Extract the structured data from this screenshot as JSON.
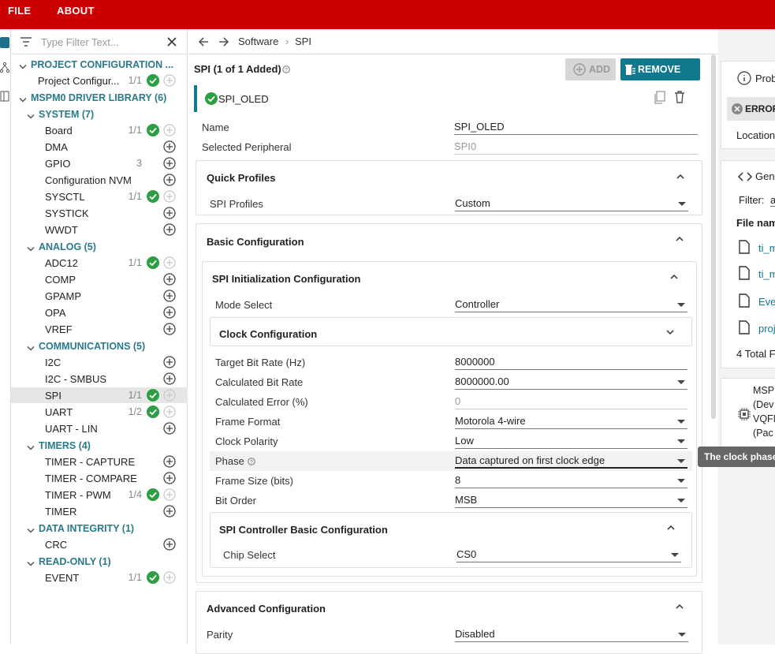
{
  "menu": {
    "file": "FILE",
    "about": "ABOUT"
  },
  "filter": {
    "placeholder": "Type Filter Text..."
  },
  "tree": {
    "project_cat": "PROJECT CONFIGURATION ...",
    "project_item": {
      "label": "Project Configur...",
      "count": "1/1"
    },
    "driver_cat": "MSPM0 DRIVER LIBRARY (6)",
    "system_cat": "SYSTEM (7)",
    "system_items": [
      {
        "label": "Board",
        "count": "1/1"
      },
      {
        "label": "DMA",
        "count": ""
      },
      {
        "label": "GPIO",
        "count": "3"
      },
      {
        "label": "Configuration NVM",
        "count": ""
      },
      {
        "label": "SYSCTL",
        "count": "1/1"
      },
      {
        "label": "SYSTICK",
        "count": ""
      },
      {
        "label": "WWDT",
        "count": ""
      }
    ],
    "analog_cat": "ANALOG (5)",
    "analog_items": [
      {
        "label": "ADC12",
        "count": "1/1"
      },
      {
        "label": "COMP",
        "count": ""
      },
      {
        "label": "GPAMP",
        "count": ""
      },
      {
        "label": "OPA",
        "count": ""
      },
      {
        "label": "VREF",
        "count": ""
      }
    ],
    "comm_cat": "COMMUNICATIONS (5)",
    "comm_items": [
      {
        "label": "I2C",
        "count": ""
      },
      {
        "label": "I2C - SMBUS",
        "count": ""
      },
      {
        "label": "SPI",
        "count": "1/1"
      },
      {
        "label": "UART",
        "count": "1/2"
      },
      {
        "label": "UART - LIN",
        "count": ""
      }
    ],
    "timers_cat": "TIMERS (4)",
    "timers_items": [
      {
        "label": "TIMER - CAPTURE",
        "count": ""
      },
      {
        "label": "TIMER - COMPARE",
        "count": ""
      },
      {
        "label": "TIMER - PWM",
        "count": "1/4"
      },
      {
        "label": "TIMER",
        "count": ""
      }
    ],
    "integrity_cat": "DATA INTEGRITY (1)",
    "integrity_items": [
      {
        "label": "CRC",
        "count": ""
      }
    ],
    "readonly_cat": "READ-ONLY (1)",
    "readonly_items": [
      {
        "label": "EVENT",
        "count": "1/1"
      }
    ]
  },
  "breadcrumb": {
    "software": "Software",
    "sep": "›",
    "spi": "SPI"
  },
  "header": {
    "title": "SPI (1 of 1 Added)",
    "add": "ADD",
    "remove_all": "REMOVE ALL"
  },
  "instance": {
    "name": "SPI_OLED"
  },
  "fields": {
    "name_label": "Name",
    "name_value": "SPI_OLED",
    "periph_label": "Selected Peripheral",
    "periph_value": "SPI0"
  },
  "quick_profiles": {
    "title": "Quick Profiles",
    "label": "SPI Profiles",
    "value": "Custom"
  },
  "basic": {
    "title": "Basic Configuration",
    "init_title": "SPI Initialization Configuration",
    "mode_label": "Mode Select",
    "mode_value": "Controller",
    "clock_title": "Clock Configuration",
    "rows": [
      {
        "label": "Target Bit Rate (Hz)",
        "value": "8000000"
      },
      {
        "label": "Calculated Bit Rate",
        "value": "8000000.00"
      },
      {
        "label": "Calculated Error (%)",
        "value": "0"
      },
      {
        "label": "Frame Format",
        "value": "Motorola 4-wire"
      },
      {
        "label": "Clock Polarity",
        "value": "Low"
      },
      {
        "label": "Phase",
        "value": "Data captured on first clock edge"
      },
      {
        "label": "Frame Size (bits)",
        "value": "8"
      },
      {
        "label": "Bit Order",
        "value": "MSB"
      }
    ],
    "controller_title": "SPI Controller Basic Configuration",
    "cs_label": "Chip Select",
    "cs_value": "CS0"
  },
  "advanced": {
    "title": "Advanced Configuration",
    "parity_label": "Parity",
    "parity_value": "Disabled"
  },
  "right": {
    "prob": "Prob",
    "error": "ERROR",
    "location": "Location",
    "gen": "Gen",
    "filter": "Filter:",
    "filter_val": "a",
    "filename": "File nam",
    "files": [
      "ti_m",
      "ti_m",
      "Eve",
      "proj"
    ],
    "total": "4 Total F",
    "device_lines": [
      "MSP",
      "(Dev",
      "VQFN",
      "(Pac"
    ]
  },
  "tooltip": "The clock phase"
}
